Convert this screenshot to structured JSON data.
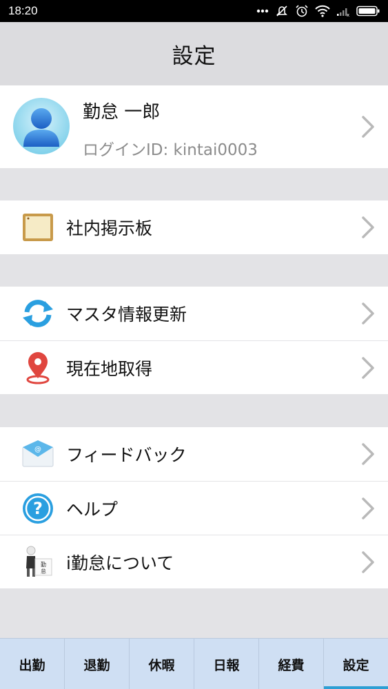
{
  "status_bar": {
    "time": "18:20",
    "icons": [
      "more-dots-icon",
      "mute-icon",
      "alarm-icon",
      "wifi-icon",
      "signal-icon",
      "battery-icon"
    ]
  },
  "header": {
    "title": "設定"
  },
  "profile": {
    "name": "勤怠 一郎",
    "login_id": "ログインID: kintai0003",
    "avatar_icon": "user-avatar-icon"
  },
  "groups": [
    {
      "items": [
        {
          "label": "社内掲示板",
          "icon": "bulletin-board-icon"
        }
      ]
    },
    {
      "items": [
        {
          "label": "マスタ情報更新",
          "icon": "refresh-icon"
        },
        {
          "label": "現在地取得",
          "icon": "location-pin-icon"
        }
      ]
    },
    {
      "items": [
        {
          "label": "フィードバック",
          "icon": "mail-icon"
        },
        {
          "label": "ヘルプ",
          "icon": "help-icon"
        },
        {
          "label": "i勤怠について",
          "icon": "about-icon"
        }
      ]
    }
  ],
  "tabs": [
    {
      "label": "出勤"
    },
    {
      "label": "退勤"
    },
    {
      "label": "休暇"
    },
    {
      "label": "日報"
    },
    {
      "label": "経費"
    },
    {
      "label": "設定",
      "active": true
    }
  ],
  "colors": {
    "accent": "#2e9fd4",
    "tabbar_bg": "#cfdff3",
    "background": "#e3e3e6"
  }
}
